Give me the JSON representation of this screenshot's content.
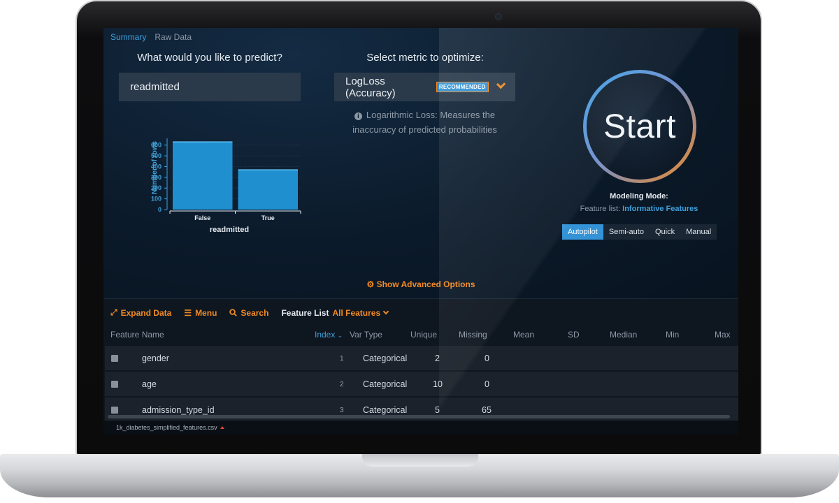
{
  "tabs": [
    {
      "label": "Summary",
      "active": true
    },
    {
      "label": "Raw Data",
      "active": false
    }
  ],
  "target": {
    "question": "What would you like to predict?",
    "value": "readmitted"
  },
  "metric": {
    "question": "Select metric to optimize:",
    "value": "LogLoss (Accuracy)",
    "badge": "RECOMMENDED",
    "description": "Logarithmic Loss: Measures the inaccuracy of predicted probabilities"
  },
  "chart_data": {
    "type": "bar",
    "categories": [
      "False",
      "True"
    ],
    "values": [
      630,
      370
    ],
    "xlabel": "readmitted",
    "ylabel": "Number of rows",
    "yticks": [
      0,
      100,
      200,
      300,
      400,
      500,
      600
    ],
    "ylim": [
      0,
      650
    ]
  },
  "start": {
    "label": "Start",
    "modeling_mode_title": "Modeling Mode:",
    "feature_list_prefix": "Feature list:",
    "feature_list_value": "Informative Features",
    "modes": [
      {
        "label": "Autopilot",
        "active": true
      },
      {
        "label": "Semi-auto",
        "active": false
      },
      {
        "label": "Quick",
        "active": false
      },
      {
        "label": "Manual",
        "active": false
      }
    ]
  },
  "advanced_options": "Show Advanced Options",
  "toolbar": {
    "expand": "Expand Data",
    "menu": "Menu",
    "search": "Search",
    "feature_list_label": "Feature List",
    "feature_list_value": "All Features"
  },
  "table": {
    "columns": [
      "Feature Name",
      "Index",
      "Var Type",
      "Unique",
      "Missing",
      "Mean",
      "SD",
      "Median",
      "Min",
      "Max"
    ],
    "rows": [
      {
        "name": "gender",
        "index": "1",
        "type": "Categorical",
        "unique": "2",
        "missing": "0"
      },
      {
        "name": "age",
        "index": "2",
        "type": "Categorical",
        "unique": "10",
        "missing": "0"
      },
      {
        "name": "admission_type_id",
        "index": "3",
        "type": "Categorical",
        "unique": "5",
        "missing": "65"
      }
    ]
  },
  "status": {
    "filename": "1k_diabetes_simplified_features.csv"
  },
  "colors": {
    "accent_blue": "#3493d6",
    "accent_orange": "#f08a24",
    "bar_fill": "#1f8fcf"
  }
}
